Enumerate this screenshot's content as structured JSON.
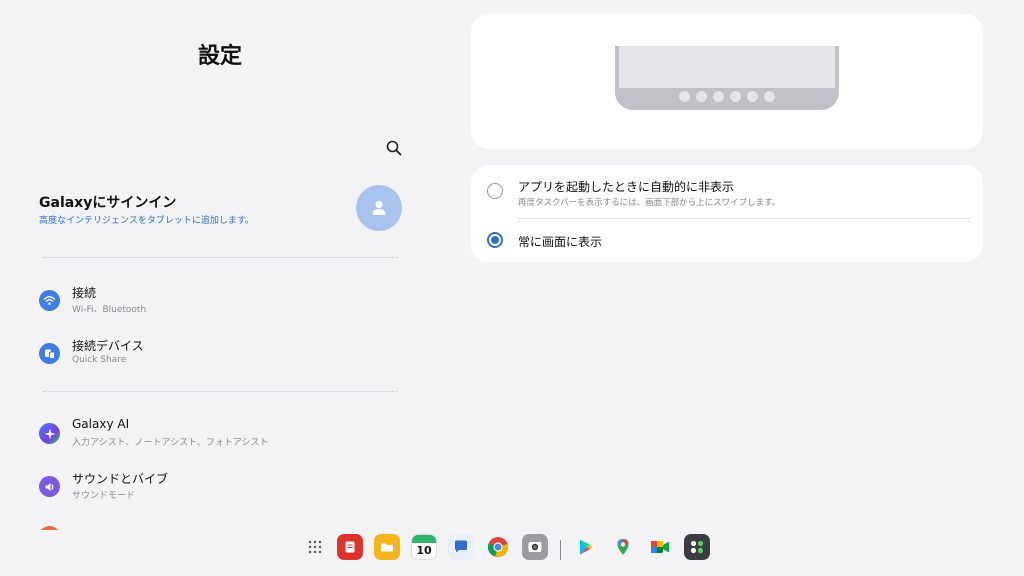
{
  "settings": {
    "title": "設定",
    "search_icon": "search-icon",
    "account": {
      "title": "Galaxyにサインイン",
      "subtitle": "高度なインテリジェンスをタブレットに追加します。",
      "icon": "person-icon"
    },
    "menu": [
      {
        "title": "接続",
        "subtitle": "Wi-Fi、Bluetooth",
        "icon": "wifi-icon",
        "color": "#3d7de6"
      },
      {
        "title": "接続デバイス",
        "subtitle": "Quick Share",
        "icon": "devices-icon",
        "color": "#3d7de6"
      },
      {
        "title": "Galaxy AI",
        "subtitle": "入力アシスト、ノートアシスト、フォトアシスト",
        "icon": "sparkle-icon",
        "color": "#5a4fcf"
      },
      {
        "title": "サウンドとバイブ",
        "subtitle": "サウンドモード",
        "icon": "volume-icon",
        "color": "#7a5be0"
      }
    ]
  },
  "taskbar_options": {
    "option_hide": {
      "label": "アプリを起動したときに自動的に非表示",
      "description": "再度タスクバーを表示するには、画面下部から上にスワイプします。",
      "selected": false
    },
    "option_always": {
      "label": "常に画面に表示",
      "selected": true
    }
  },
  "taskbar": {
    "apps": [
      {
        "name": "app-drawer-icon"
      },
      {
        "name": "notes-app-icon",
        "color": "#e0322d"
      },
      {
        "name": "my-files-icon",
        "color": "#f3b519"
      },
      {
        "name": "calendar-icon",
        "day": "10",
        "color": "#2db36b"
      },
      {
        "name": "messages-icon",
        "color": "#2d6fd1"
      },
      {
        "name": "chrome-icon"
      },
      {
        "name": "camera-icon"
      },
      {
        "name": "play-store-icon"
      },
      {
        "name": "maps-icon"
      },
      {
        "name": "meet-icon"
      },
      {
        "name": "calculator-icon"
      }
    ]
  },
  "colors": {
    "accent": "#2d6fd1",
    "background": "#f3f3f5",
    "card": "#ffffff"
  }
}
